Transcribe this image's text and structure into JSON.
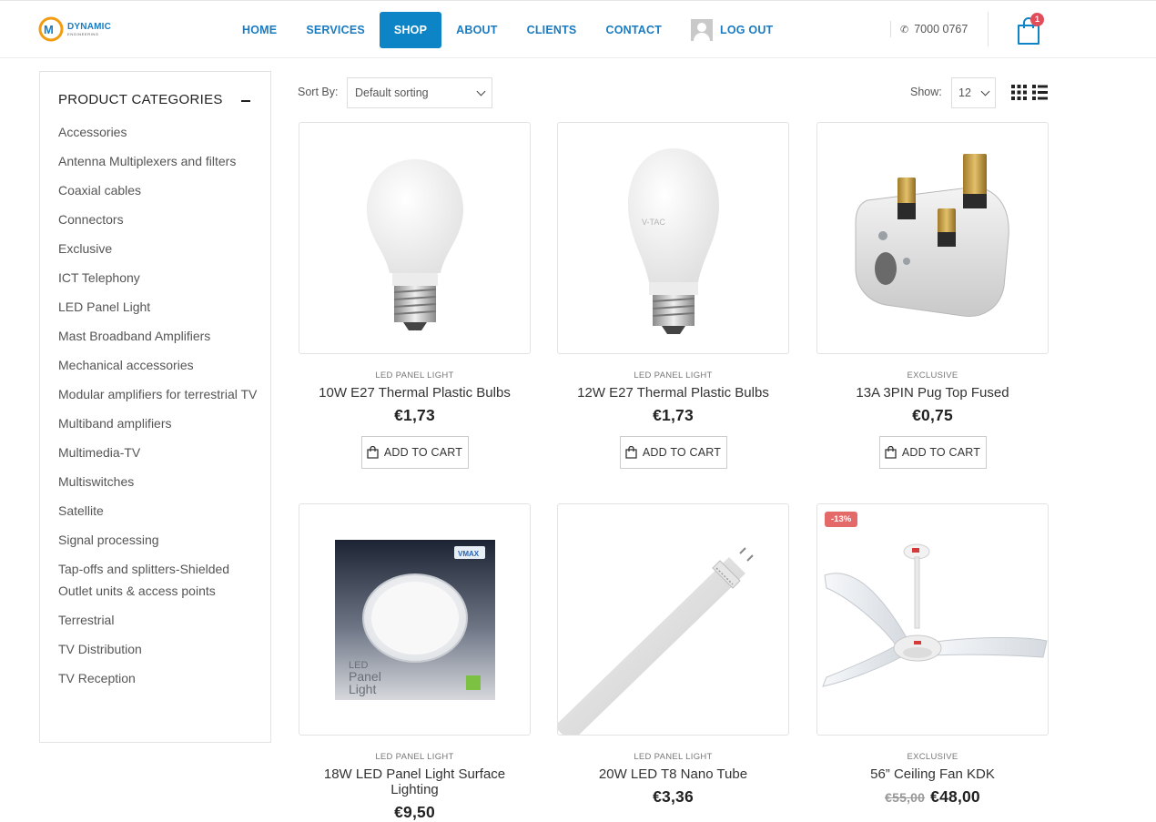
{
  "brand": {
    "name": "DYNAMIC",
    "tagline": "ENGINEERING",
    "colors": {
      "primary": "#1a7bc0",
      "accent": "#f39c12",
      "sale": "#e46a6a"
    }
  },
  "nav": {
    "items": [
      {
        "label": "HOME"
      },
      {
        "label": "SERVICES"
      },
      {
        "label": "SHOP",
        "active": true
      },
      {
        "label": "ABOUT"
      },
      {
        "label": "CLIENTS"
      },
      {
        "label": "CONTACT"
      }
    ],
    "logout_label": "LOG OUT"
  },
  "header": {
    "phone": "7000 0767",
    "cart_count": "1"
  },
  "sidebar": {
    "title": "PRODUCT CATEGORIES",
    "categories": [
      "Accessories",
      "Antenna Multiplexers and filters",
      "Coaxial cables",
      "Connectors",
      "Exclusive",
      "ICT Telephony",
      "LED Panel Light",
      "Mast Broadband Amplifiers",
      "Mechanical accessories",
      "Modular amplifiers for terrestrial TV",
      "Multiband amplifiers",
      "Multimedia-TV",
      "Multiswitches",
      "Satellite",
      "Signal processing",
      "Tap-offs and splitters-Shielded Outlet units & access points",
      "Terrestrial",
      "TV Distribution",
      "TV Reception"
    ]
  },
  "toolbar": {
    "sort_label": "Sort By:",
    "sort_value": "Default sorting",
    "show_label": "Show:",
    "show_value": "12"
  },
  "products": [
    {
      "category": "LED PANEL LIGHT",
      "name": "10W E27 Thermal Plastic Bulbs",
      "price": "€1,73",
      "button": "ADD TO CART"
    },
    {
      "category": "LED PANEL LIGHT",
      "name": "12W E27 Thermal Plastic Bulbs",
      "price": "€1,73",
      "button": "ADD TO CART",
      "image_text": "V-TAC"
    },
    {
      "category": "EXCLUSIVE",
      "name": "13A 3PIN Pug Top Fused",
      "price": "€0,75",
      "button": "ADD TO CART"
    },
    {
      "category": "LED PANEL LIGHT",
      "name": "18W LED Panel Light Surface Lighting",
      "price": "€9,50",
      "image_text": {
        "brand": "VMAX",
        "line1": "LED",
        "line2": "Panel",
        "line3": "Light"
      }
    },
    {
      "category": "LED PANEL LIGHT",
      "name": "20W LED T8 Nano Tube",
      "price": "€3,36"
    },
    {
      "category": "EXCLUSIVE",
      "name": "56” Ceiling Fan KDK",
      "price": "€48,00",
      "old_price": "€55,00",
      "badge": "-13%"
    }
  ]
}
